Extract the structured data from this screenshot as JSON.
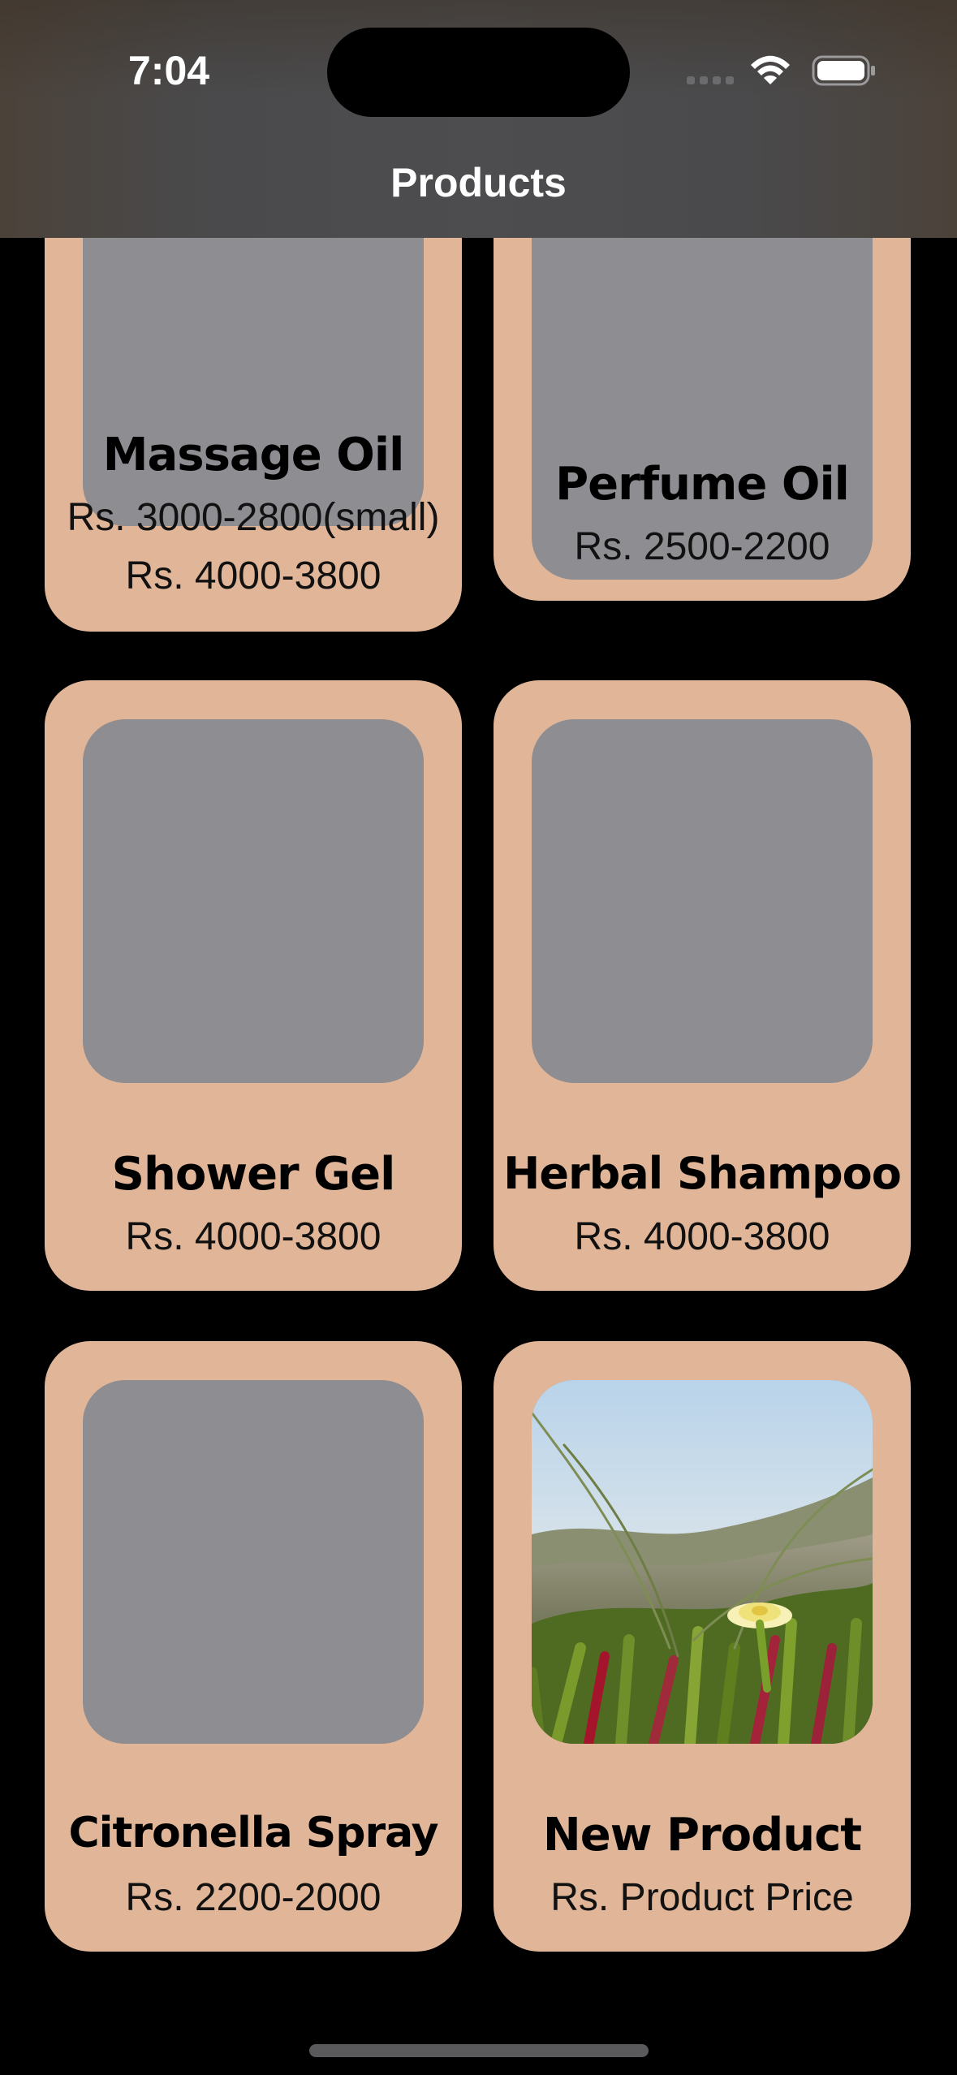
{
  "status_bar": {
    "time": "7:04"
  },
  "nav": {
    "title": "Products"
  },
  "products": [
    {
      "name": "Massage Oil",
      "price": "Rs. 3000-2800(small)",
      "price2": "Rs. 4000-3800"
    },
    {
      "name": "Perfume Oil",
      "price": "Rs. 2500-2200"
    },
    {
      "name": "Shower Gel",
      "price": "Rs. 4000-3800"
    },
    {
      "name": "Herbal Shampoo",
      "price": "Rs. 4000-3800"
    },
    {
      "name": "Citronella Spray",
      "price": "Rs. 2200-2000"
    },
    {
      "name": "New Product",
      "price": "Rs. Product Price"
    }
  ],
  "colors": {
    "card": "#E1B597",
    "placeholder": "#8E8D92",
    "background": "#000000"
  },
  "icons": [
    "signal-icon",
    "wifi-icon",
    "battery-icon"
  ]
}
